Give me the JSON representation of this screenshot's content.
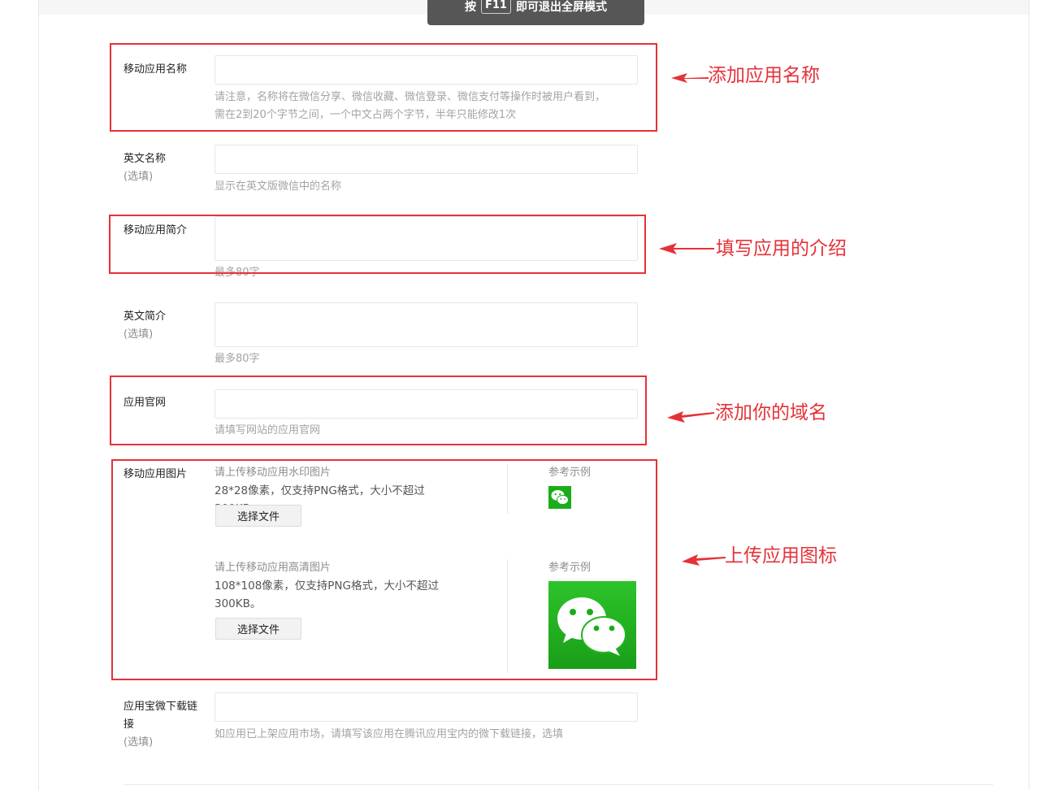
{
  "fullscreen_tip": {
    "prefix": "按",
    "key": "F11",
    "suffix": "即可退出全屏模式"
  },
  "form": {
    "app_name": {
      "label": "移动应用名称",
      "hint_line1": "请注意，名称将在微信分享、微信收藏、微信登录、微信支付等操作时被用户看到，",
      "hint_line2": "需在2到20个字节之间，一个中文占两个字节，半年只能修改1次",
      "value": ""
    },
    "english_name": {
      "label": "英文名称",
      "optional": "(选填)",
      "hint": "显示在英文版微信中的名称",
      "value": ""
    },
    "app_intro": {
      "label": "移动应用简介",
      "hint": "最多80字",
      "value": ""
    },
    "english_intro": {
      "label": "英文简介",
      "optional": "(选填)",
      "hint": "最多80字",
      "value": ""
    },
    "website": {
      "label": "应用官网",
      "hint": "请填写网站的应用官网",
      "value": ""
    },
    "app_image": {
      "label": "移动应用图片",
      "watermark": {
        "title": "请上传移动应用水印图片",
        "spec": "28*28像素，仅支持PNG格式，大小不超过300KB。",
        "button": "选择文件",
        "ref_label": "参考示例"
      },
      "hd": {
        "title": "请上传移动应用高清图片",
        "spec_line1": "108*108像素，仅支持PNG格式，大小不超过",
        "spec_line2": "300KB。",
        "button": "选择文件",
        "ref_label": "参考示例"
      }
    },
    "yyb_link": {
      "label_line1": "应用宝微下载链",
      "label_line2": "接",
      "optional": "(选填)",
      "hint": "如应用已上架应用市场，请填写该应用在腾讯应用宝内的微下载链接，选填",
      "value": ""
    }
  },
  "annotations": {
    "name": "添加应用名称",
    "intro": "填写应用的介绍",
    "domain": "添加你的域名",
    "icon": "上传应用图标"
  },
  "colors": {
    "annotation_red": "#e53238",
    "wechat_green": "#1aad19",
    "hint_gray": "#a3a3a3",
    "border": "#e7e7eb"
  },
  "icons": [
    "wechat-logo-small-icon",
    "wechat-logo-large-icon",
    "red-arrow-icon"
  ]
}
